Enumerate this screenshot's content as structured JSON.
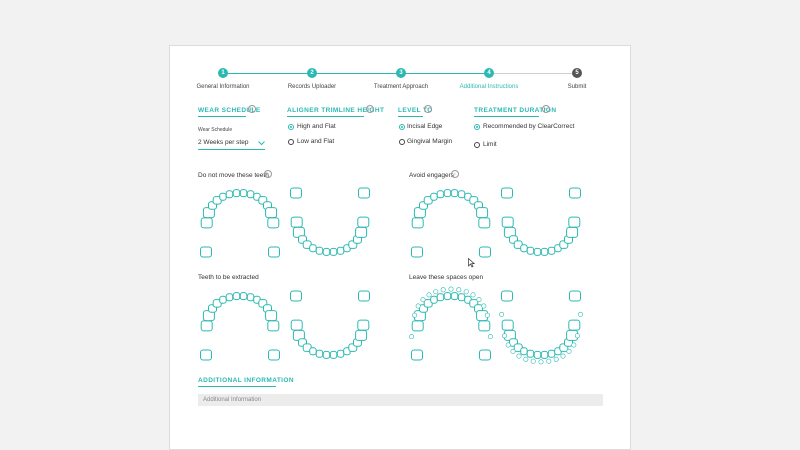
{
  "stepper": {
    "steps": [
      {
        "num": "1",
        "label": "General Information",
        "state": "complete"
      },
      {
        "num": "2",
        "label": "Records Uploader",
        "state": "complete"
      },
      {
        "num": "3",
        "label": "Treatment Approach",
        "state": "complete"
      },
      {
        "num": "4",
        "label": "Additional Instructions",
        "state": "active"
      },
      {
        "num": "5",
        "label": "Submit",
        "state": "pending"
      }
    ]
  },
  "wear_schedule": {
    "title": "WEAR SCHEDULE",
    "field_label": "Wear Schedule",
    "selected": "2 Weeks per step"
  },
  "aligner_trimline": {
    "title": "ALIGNER TRIMLINE HEIGHT",
    "options": [
      {
        "label": "High and Flat",
        "selected": true
      },
      {
        "label": "Low and Flat",
        "selected": false
      }
    ]
  },
  "level_to": {
    "title": "LEVEL TO",
    "options": [
      {
        "label": "Incisal Edge",
        "selected": true
      },
      {
        "label": "Gingival Margin",
        "selected": false
      }
    ]
  },
  "treatment_duration": {
    "title": "TREATMENT DURATION",
    "options": [
      {
        "label": "Recommended by ClearCorrect",
        "selected": true
      },
      {
        "label": "Limit",
        "selected": false
      }
    ]
  },
  "charts": {
    "do_not_move": "Do not move these teeth",
    "avoid_engagers": "Avoid engagers",
    "extract": "Teeth to be extracted",
    "spaces_open": "Leave these spaces open"
  },
  "additional_info": {
    "title": "ADDITIONAL INFORMATION",
    "placeholder": "Additional Information"
  },
  "colors": {
    "accent": "#2bb9b2",
    "pending": "#555555"
  }
}
